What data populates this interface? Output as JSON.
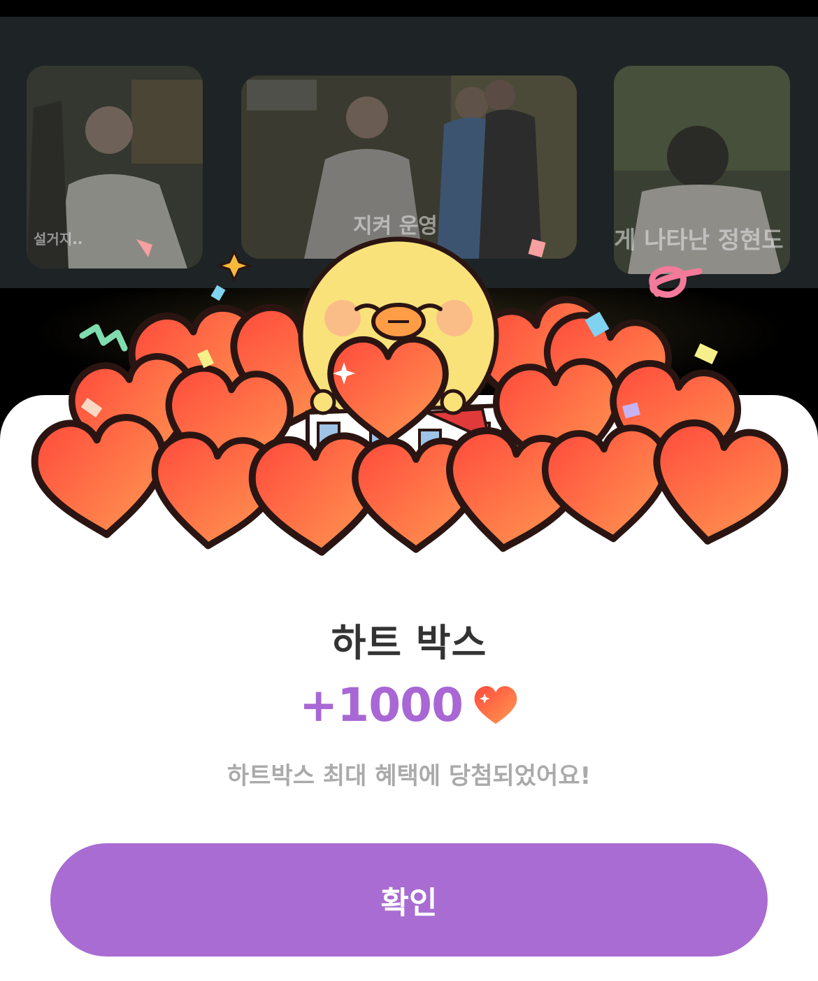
{
  "background_carousel": {
    "thumbnails": [
      {
        "subtitle": "설거지.."
      },
      {
        "subtitle": "지켜 운영"
      },
      {
        "subtitle": "게 나타난 정현도"
      }
    ]
  },
  "reward_sheet": {
    "title": "하트 박스",
    "amount": "+1000",
    "amount_icon": "heart-icon",
    "message": "하트박스 최대 혜택에 당첨되었어요!",
    "confirm_label": "확인"
  },
  "colors": {
    "accent_purple": "#a86cd2",
    "amount_purple": "#a867d4",
    "heart_red": "#ff4a3c",
    "heart_orange": "#ff9a52",
    "title_text": "#333333",
    "message_text": "#aaaaaa"
  }
}
